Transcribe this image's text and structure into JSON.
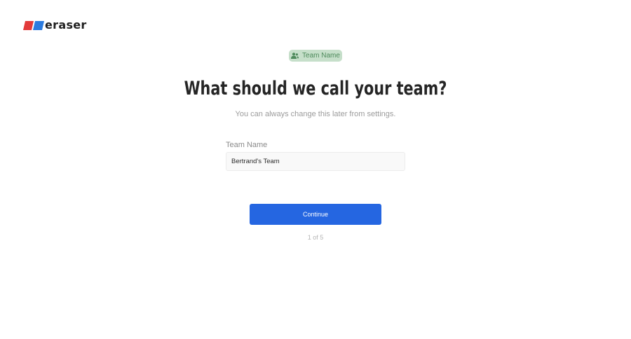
{
  "brand": {
    "name": "eraser",
    "colors": {
      "red": "#e23a3a",
      "blue": "#2b7be0"
    }
  },
  "badge": {
    "icon": "user-group-icon",
    "label": "Team Name",
    "background": "#c6dfca",
    "text_color": "#4e8a5c"
  },
  "heading": "What should we call your team?",
  "subtitle": "You can always change this later from settings.",
  "form": {
    "team_name_label": "Team Name",
    "team_name_value": "Bertrand's Team"
  },
  "actions": {
    "continue_label": "Continue",
    "continue_color": "#2566e1"
  },
  "progress": {
    "text": "1 of 5",
    "current_step": 1,
    "total_steps": 5
  }
}
